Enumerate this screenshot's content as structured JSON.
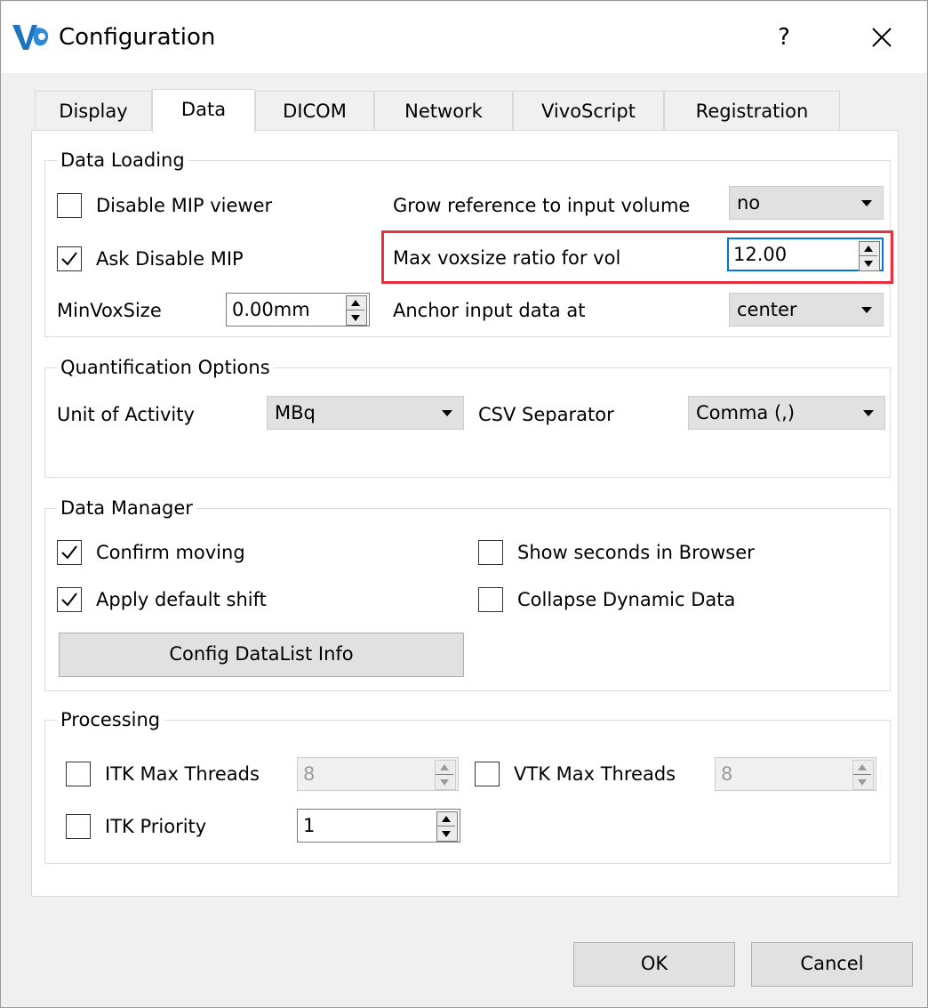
{
  "window": {
    "title": "Configuration",
    "help_label": "?",
    "close_label": "×"
  },
  "tabs": [
    {
      "label": "Display",
      "active": false
    },
    {
      "label": "Data",
      "active": true
    },
    {
      "label": "DICOM",
      "active": false
    },
    {
      "label": "Network",
      "active": false
    },
    {
      "label": "VivoScript",
      "active": false
    },
    {
      "label": "Registration",
      "active": false
    }
  ],
  "data_loading": {
    "title": "Data Loading",
    "disable_mip": {
      "label": "Disable MIP viewer",
      "checked": false
    },
    "ask_disable_mip": {
      "label": "Ask Disable MIP",
      "checked": true
    },
    "min_vox_size": {
      "label": "MinVoxSize",
      "value": "0.00mm"
    },
    "grow_reference": {
      "label": "Grow reference to input volume",
      "value": "no"
    },
    "max_voxsize_ratio": {
      "label": "Max voxsize ratio for vol",
      "value": "12.00"
    },
    "anchor": {
      "label": "Anchor input data at",
      "value": "center"
    }
  },
  "quantification": {
    "title": "Quantification Options",
    "unit": {
      "label": "Unit of Activity",
      "value": "MBq"
    },
    "csv": {
      "label": "CSV Separator",
      "value": "Comma (,)"
    }
  },
  "data_manager": {
    "title": "Data Manager",
    "confirm_moving": {
      "label": "Confirm moving",
      "checked": true
    },
    "apply_shift": {
      "label": "Apply default shift",
      "checked": true
    },
    "show_seconds": {
      "label": "Show seconds in Browser",
      "checked": false
    },
    "collapse_dynamic": {
      "label": "Collapse Dynamic Data",
      "checked": false
    },
    "config_button": "Config DataList Info"
  },
  "processing": {
    "title": "Processing",
    "itk_threads": {
      "label": "ITK Max Threads",
      "value": "8",
      "checked": false
    },
    "vtk_threads": {
      "label": "VTK Max Threads",
      "value": "8",
      "checked": false
    },
    "itk_priority": {
      "label": "ITK Priority",
      "value": "1",
      "checked": false
    }
  },
  "footer": {
    "ok": "OK",
    "cancel": "Cancel"
  },
  "colors": {
    "highlight": "#e8303c",
    "focus": "#0078d7",
    "icon_blue": "#1e73be"
  }
}
